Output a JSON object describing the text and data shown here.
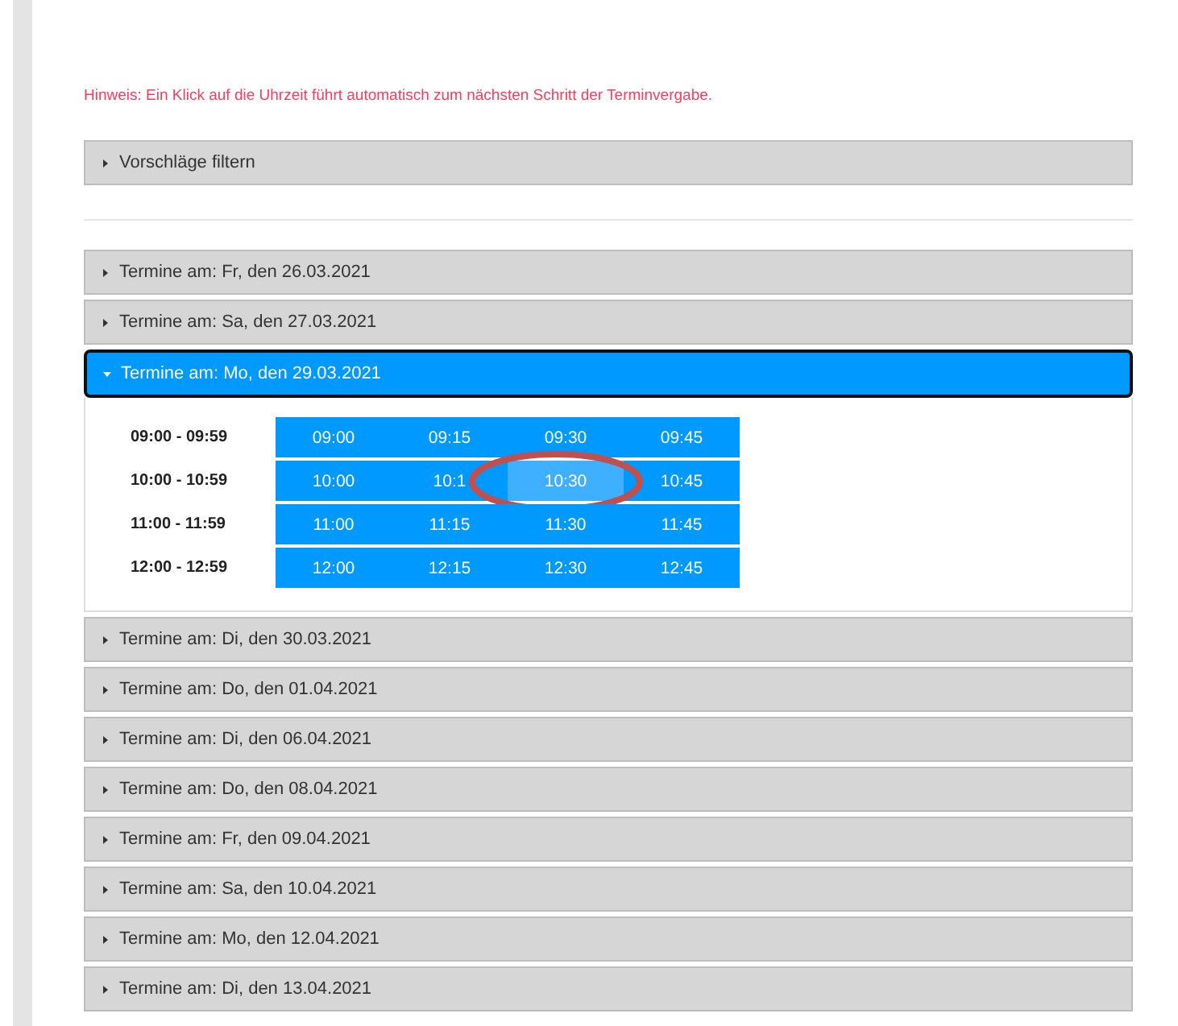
{
  "hint": "Hinweis: Ein Klick auf die Uhrzeit führt automatisch zum nächsten Schritt der Terminvergabe.",
  "filter": {
    "label": "Vorschläge filtern",
    "expanded": false
  },
  "days": [
    {
      "label": "Termine am: Fr, den 26.03.2021",
      "expanded": false
    },
    {
      "label": "Termine am: Sa, den 27.03.2021",
      "expanded": false
    },
    {
      "label": "Termine am: Mo, den 29.03.2021",
      "expanded": true,
      "hours": [
        {
          "range": "09:00 - 09:59",
          "slots": [
            {
              "time": "09:00",
              "selected": false
            },
            {
              "time": "09:15",
              "selected": false
            },
            {
              "time": "09:30",
              "selected": false
            },
            {
              "time": "09:45",
              "selected": false
            }
          ]
        },
        {
          "range": "10:00 - 10:59",
          "slots": [
            {
              "time": "10:00",
              "selected": false
            },
            {
              "time": "10:1",
              "selected": false
            },
            {
              "time": "10:30",
              "selected": true
            },
            {
              "time": "10:45",
              "selected": false
            }
          ]
        },
        {
          "range": "11:00 - 11:59",
          "slots": [
            {
              "time": "11:00",
              "selected": false
            },
            {
              "time": "11:15",
              "selected": false
            },
            {
              "time": "11:30",
              "selected": false
            },
            {
              "time": "11:45",
              "selected": false
            }
          ]
        },
        {
          "range": "12:00 - 12:59",
          "slots": [
            {
              "time": "12:00",
              "selected": false
            },
            {
              "time": "12:15",
              "selected": false
            },
            {
              "time": "12:30",
              "selected": false
            },
            {
              "time": "12:45",
              "selected": false
            }
          ]
        }
      ]
    },
    {
      "label": "Termine am: Di, den 30.03.2021",
      "expanded": false
    },
    {
      "label": "Termine am: Do, den 01.04.2021",
      "expanded": false
    },
    {
      "label": "Termine am: Di, den 06.04.2021",
      "expanded": false
    },
    {
      "label": "Termine am: Do, den 08.04.2021",
      "expanded": false
    },
    {
      "label": "Termine am: Fr, den 09.04.2021",
      "expanded": false
    },
    {
      "label": "Termine am: Sa, den 10.04.2021",
      "expanded": false
    },
    {
      "label": "Termine am: Mo, den 12.04.2021",
      "expanded": false
    },
    {
      "label": "Termine am: Di, den 13.04.2021",
      "expanded": false
    }
  ]
}
